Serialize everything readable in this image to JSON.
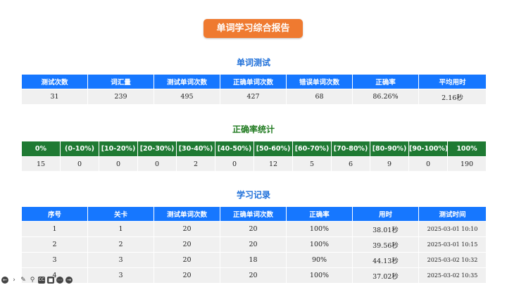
{
  "title": "单词学习综合报告",
  "test_section": {
    "heading": "单词测试",
    "headers": [
      "测试次数",
      "词汇量",
      "测试单词次数",
      "正确单词次数",
      "错误单词次数",
      "正确率",
      "平均用时"
    ],
    "values": [
      "31",
      "239",
      "495",
      "427",
      "68",
      "86.26%",
      "2.16秒"
    ]
  },
  "accuracy_section": {
    "heading": "正确率统计",
    "headers": [
      "0%",
      "(0-10%)",
      "[10-20%)",
      "[20-30%)",
      "[30-40%)",
      "[40-50%)",
      "[50-60%)",
      "[60-70%)",
      "[70-80%)",
      "[80-90%)",
      "[90-100%)",
      "100%"
    ],
    "values": [
      "15",
      "0",
      "0",
      "0",
      "2",
      "0",
      "12",
      "5",
      "6",
      "9",
      "0",
      "190"
    ]
  },
  "records_section": {
    "heading": "学习记录",
    "headers": [
      "序号",
      "关卡",
      "测试单词次数",
      "正确单词次数",
      "正确率",
      "用时",
      "测试时间"
    ],
    "rows": [
      [
        "1",
        "1",
        "20",
        "20",
        "100%",
        "38.01秒",
        "2025-03-01 10:10"
      ],
      [
        "2",
        "2",
        "20",
        "20",
        "100%",
        "39.56秒",
        "2025-03-01 10:15"
      ],
      [
        "3",
        "3",
        "20",
        "18",
        "90%",
        "44.13秒",
        "2025-03-02 10:32"
      ],
      [
        "4",
        "3",
        "20",
        "20",
        "100%",
        "37.02秒",
        "2025-03-02 10:35"
      ]
    ]
  },
  "toolbar": {
    "icons": [
      "arrow-left-icon",
      "arrow-right-icon",
      "pencil-icon",
      "search-icon",
      "cc-icon",
      "camera-icon",
      "more-icon",
      "arrow-right-circle-icon"
    ]
  }
}
